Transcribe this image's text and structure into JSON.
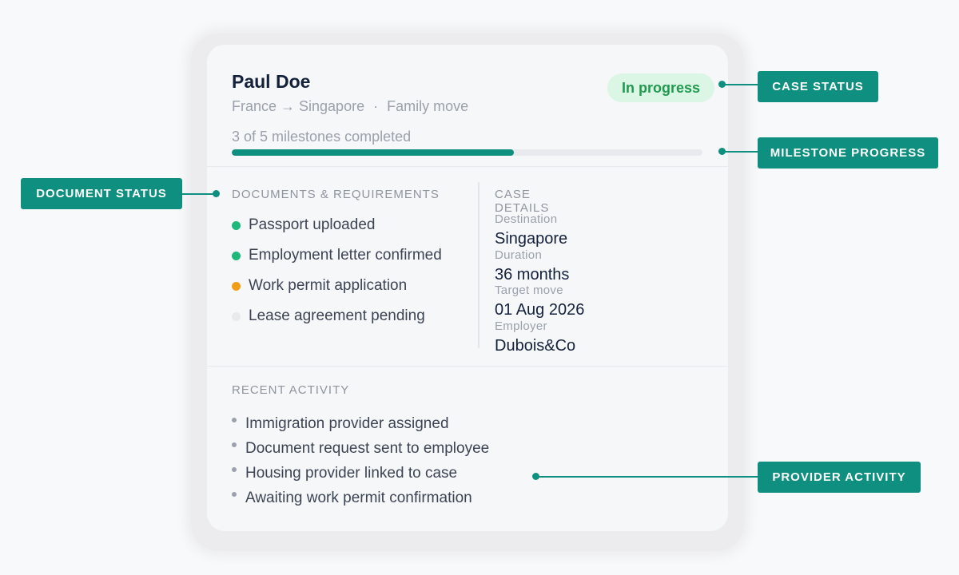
{
  "case": {
    "name": "Paul Doe",
    "route": "France → Singapore",
    "move_type": "Family move",
    "route_separator": "·",
    "status": "In progress",
    "milestones_text": "3 of 5 milestones completed",
    "milestones_completed": 3,
    "milestones_total": 5
  },
  "documents": {
    "title": "DOCUMENTS & REQUIREMENTS",
    "items": [
      {
        "label": "Passport uploaded",
        "state": "complete",
        "color": "#1db87a"
      },
      {
        "label": "Employment letter confirmed",
        "state": "complete",
        "color": "#1db87a"
      },
      {
        "label": "Work permit application",
        "state": "in-progress",
        "color": "#f29d17"
      },
      {
        "label": "Lease agreement pending",
        "state": "pending",
        "color": "#e9eaec"
      }
    ]
  },
  "details": {
    "title": "CASE DETAILS",
    "fields": [
      {
        "label": "Destination",
        "value": "Singapore"
      },
      {
        "label": "Duration",
        "value": "36 months"
      },
      {
        "label": "Target move",
        "value": "01 Aug 2026"
      },
      {
        "label": "Employer",
        "value": "Dubois&Co"
      }
    ]
  },
  "activity": {
    "title": "RECENT ACTIVITY",
    "items": [
      "Immigration provider assigned",
      "Document request sent to employee",
      "Housing provider linked to case",
      "Awaiting work permit confirmation"
    ]
  },
  "callouts": {
    "case_status": "CASE STATUS",
    "milestone_progress": "MILESTONE PROGRESS",
    "document_status": "DOCUMENT STATUS",
    "provider_activity": "PROVIDER ACTIVITY"
  },
  "colors": {
    "accent": "#0f8f7f",
    "status_bg": "#dcf6e6",
    "status_text": "#1f9a4f"
  }
}
